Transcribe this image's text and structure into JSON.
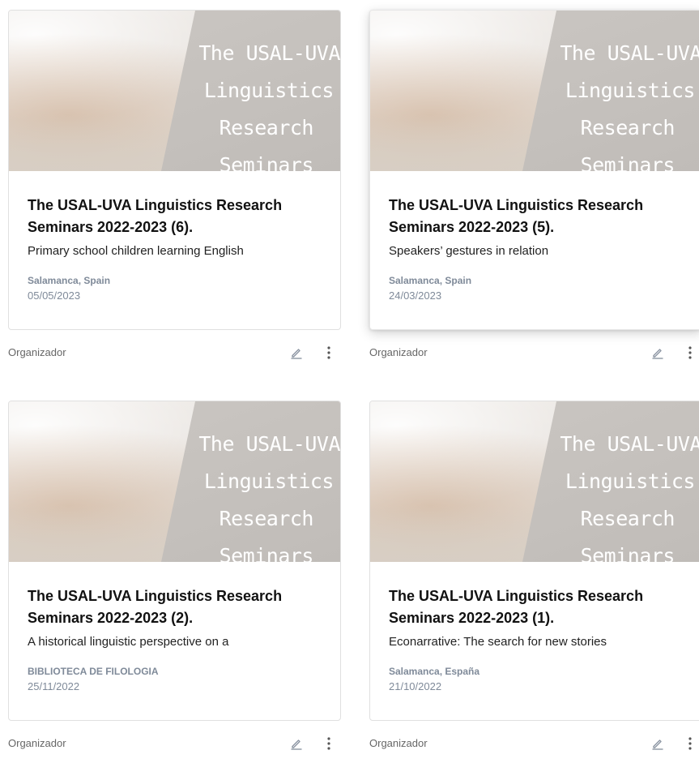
{
  "banner_lines": [
    "The USAL-UVA",
    "Linguistics",
    "Research",
    "Seminars"
  ],
  "events": [
    {
      "title": "The USAL-UVA Linguistics Research Seminars 2022-2023 (6).",
      "description": "Primary school children learning English",
      "location": "Salamanca, Spain",
      "date": "05/05/2023",
      "organizer_label": "Organizador"
    },
    {
      "title": "The USAL-UVA Linguistics Research Seminars 2022-2023 (5).",
      "description": "Speakers’ gestures in relation",
      "location": "Salamanca, Spain",
      "date": "24/03/2023",
      "organizer_label": "Organizador"
    },
    {
      "title": "The USAL-UVA Linguistics Research Seminars 2022-2023 (2).",
      "description": "A historical linguistic perspective on a",
      "location": "BIBLIOTECA DE FILOLOGIA",
      "date": "25/11/2022",
      "organizer_label": "Organizador"
    },
    {
      "title": "The USAL-UVA Linguistics Research Seminars 2022-2023 (1).",
      "description": "Econarrative: The search for new stories",
      "location": "Salamanca, España",
      "date": "21/10/2022",
      "organizer_label": "Organizador"
    }
  ],
  "icons": {
    "edit": "pencil-icon",
    "more": "more-vert-icon"
  },
  "colors": {
    "meta_text": "#7f8a99",
    "title_text": "#111111"
  }
}
